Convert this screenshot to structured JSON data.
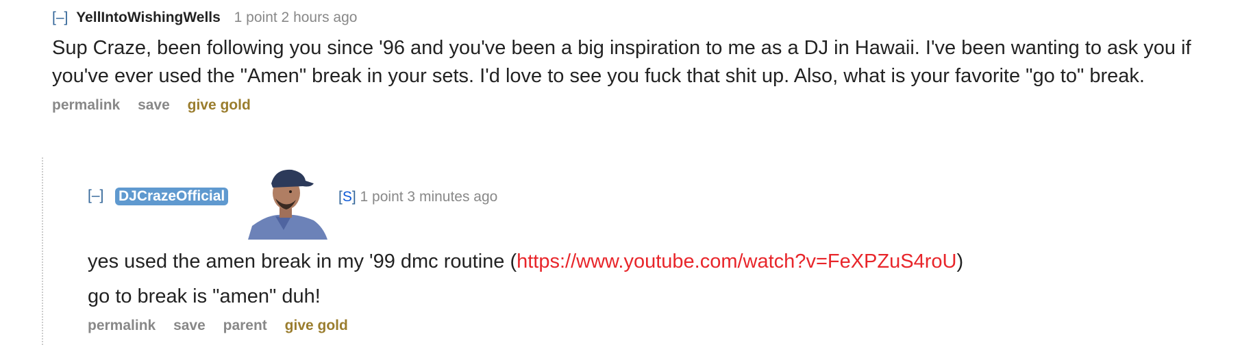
{
  "parent": {
    "expand": "[–]",
    "author": "YellIntoWishingWells",
    "meta": "1 point 2 hours ago",
    "body": "Sup Craze, been following you since '96 and you've been a big inspiration to me as a DJ in Hawaii. I've been wanting to ask you if you've ever used the \"Amen\" break in your sets. I'd love to see you fuck that shit up. Also, what is your favorite \"go to\" break.",
    "buttons": {
      "permalink": "permalink",
      "save": "save",
      "give_gold": "give gold"
    }
  },
  "reply": {
    "expand": "[–]",
    "author": "DJCrazeOfficial",
    "submitter_open": "[",
    "submitter_letter": "S",
    "submitter_close": "]",
    "meta": "1 point 3 minutes ago",
    "line1_prefix": "yes used the amen break in my '99 dmc routine (",
    "line1_link": "https://www.youtube.com/watch?v=FeXPZuS4roU",
    "line1_suffix": ")",
    "line2": "go to break is \"amen\" duh!",
    "buttons": {
      "permalink": "permalink",
      "save": "save",
      "parent": "parent",
      "give_gold": "give gold"
    }
  },
  "colors": {
    "link": "#e8252a",
    "op_badge": "#5f99cf",
    "gold": "#9a7d2e",
    "expand": "#336699"
  }
}
